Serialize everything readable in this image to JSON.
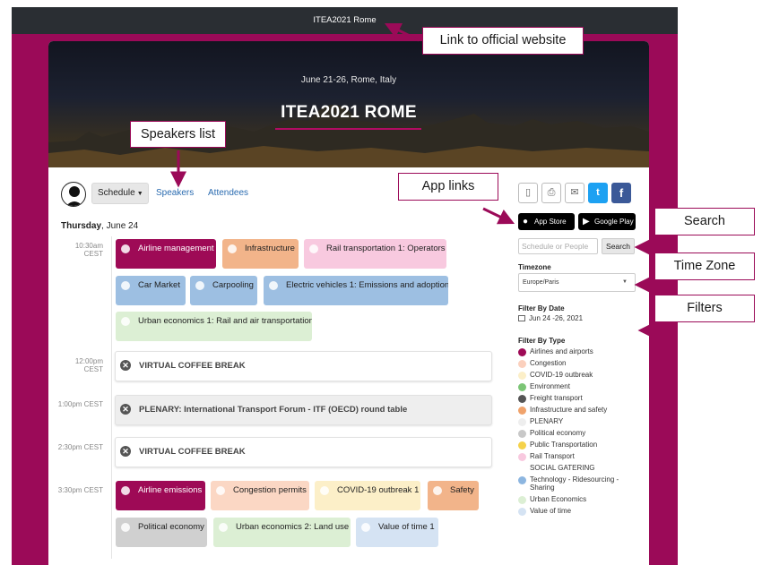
{
  "top_link": "ITEA2021 Rome",
  "hero": {
    "date": "June 21-26, Rome, Italy",
    "title": "ITEA2021 ROME"
  },
  "nav": {
    "schedule": "Schedule",
    "speakers": "Speakers",
    "attendees": "Attendees"
  },
  "day": {
    "weekday": "Thursday",
    "date": ", June 24"
  },
  "time_slots": [
    {
      "time": "10:30am",
      "zone": "CEST"
    },
    {
      "time": "12:00pm",
      "zone": "CEST"
    },
    {
      "time": "1:00pm CEST",
      "zone": ""
    },
    {
      "time": "2:30pm CEST",
      "zone": ""
    },
    {
      "time": "3:30pm CEST",
      "zone": ""
    }
  ],
  "sessions_1030": [
    {
      "label": "Airline management",
      "color": "#9e0a56",
      "text_color": "#ffffff"
    },
    {
      "label": "Infrastructure",
      "color": "#f2b48a",
      "text_color": "#222222"
    },
    {
      "label": "Rail transportation 1: Operators",
      "color": "#f8c9df",
      "text_color": "#222222"
    },
    {
      "label": "Car Market",
      "color": "#9dbfe2",
      "text_color": "#222222"
    },
    {
      "label": "Carpooling",
      "color": "#9dbfe2",
      "text_color": "#222222"
    },
    {
      "label": "Electric vehicles 1: Emissions and adoption",
      "color": "#9dbfe2",
      "text_color": "#222222"
    },
    {
      "label": "Urban economics 1: Rail and air transportation",
      "color": "#dcefd4",
      "text_color": "#222222"
    }
  ],
  "breaks": [
    {
      "label": "VIRTUAL COFFEE BREAK"
    },
    {
      "label": "PLENARY: International Transport Forum - ITF (OECD) round table"
    },
    {
      "label": "VIRTUAL COFFEE BREAK"
    }
  ],
  "sessions_1530": [
    {
      "label": "Airline emissions",
      "color": "#9e0a56",
      "text_color": "#ffffff"
    },
    {
      "label": "Congestion permits",
      "color": "#fbd7c4",
      "text_color": "#222222"
    },
    {
      "label": "COVID-19 outbreak 1",
      "color": "#fcefc8",
      "text_color": "#222222"
    },
    {
      "label": "Safety",
      "color": "#f2b48a",
      "text_color": "#222222"
    },
    {
      "label": "Political economy",
      "color": "#d0d0d0",
      "text_color": "#222222"
    },
    {
      "label": "Urban economics 2: Land use",
      "color": "#dcefd4",
      "text_color": "#222222"
    },
    {
      "label": "Value of time 1",
      "color": "#d5e3f3",
      "text_color": "#222222"
    }
  ],
  "apps": {
    "app_store": "App Store",
    "google_play": "Google Play"
  },
  "search": {
    "placeholder": "Schedule or People",
    "button": "Search"
  },
  "timezone": {
    "label": "Timezone",
    "value": "Europe/Paris"
  },
  "filter_date": {
    "label": "Filter By Date",
    "value": "Jun 24 -26, 2021"
  },
  "filter_type": {
    "label": "Filter By Type",
    "items": [
      {
        "label": "Airlines and airports",
        "color": "#9e0a56"
      },
      {
        "label": "Congestion",
        "color": "#fbd0bd"
      },
      {
        "label": "COVID-19 outbreak",
        "color": "#fcefc8"
      },
      {
        "label": "Environment",
        "color": "#7cc576"
      },
      {
        "label": "Freight transport",
        "color": "#555555"
      },
      {
        "label": "Infrastructure and safety",
        "color": "#f0a36c"
      },
      {
        "label": "PLENARY",
        "color": "#eeeeee"
      },
      {
        "label": "Political economy",
        "color": "#c8c8c8"
      },
      {
        "label": "Public Transportation",
        "color": "#f5d24a"
      },
      {
        "label": "Rail Transport",
        "color": "#f8c9df"
      },
      {
        "label": "SOCIAL GATERING",
        "color": "#ffffff"
      },
      {
        "label": "Technology - Ridesourcing - Sharing",
        "color": "#8db6e0"
      },
      {
        "label": "Urban Economics",
        "color": "#dcefd4"
      },
      {
        "label": "Value of time",
        "color": "#d5e3f3"
      }
    ]
  },
  "callouts": {
    "official_site": "Link to official website",
    "speakers": "Speakers list",
    "app_links": "App links",
    "search": "Search",
    "time_zone": "Time Zone",
    "filters": "Filters"
  }
}
